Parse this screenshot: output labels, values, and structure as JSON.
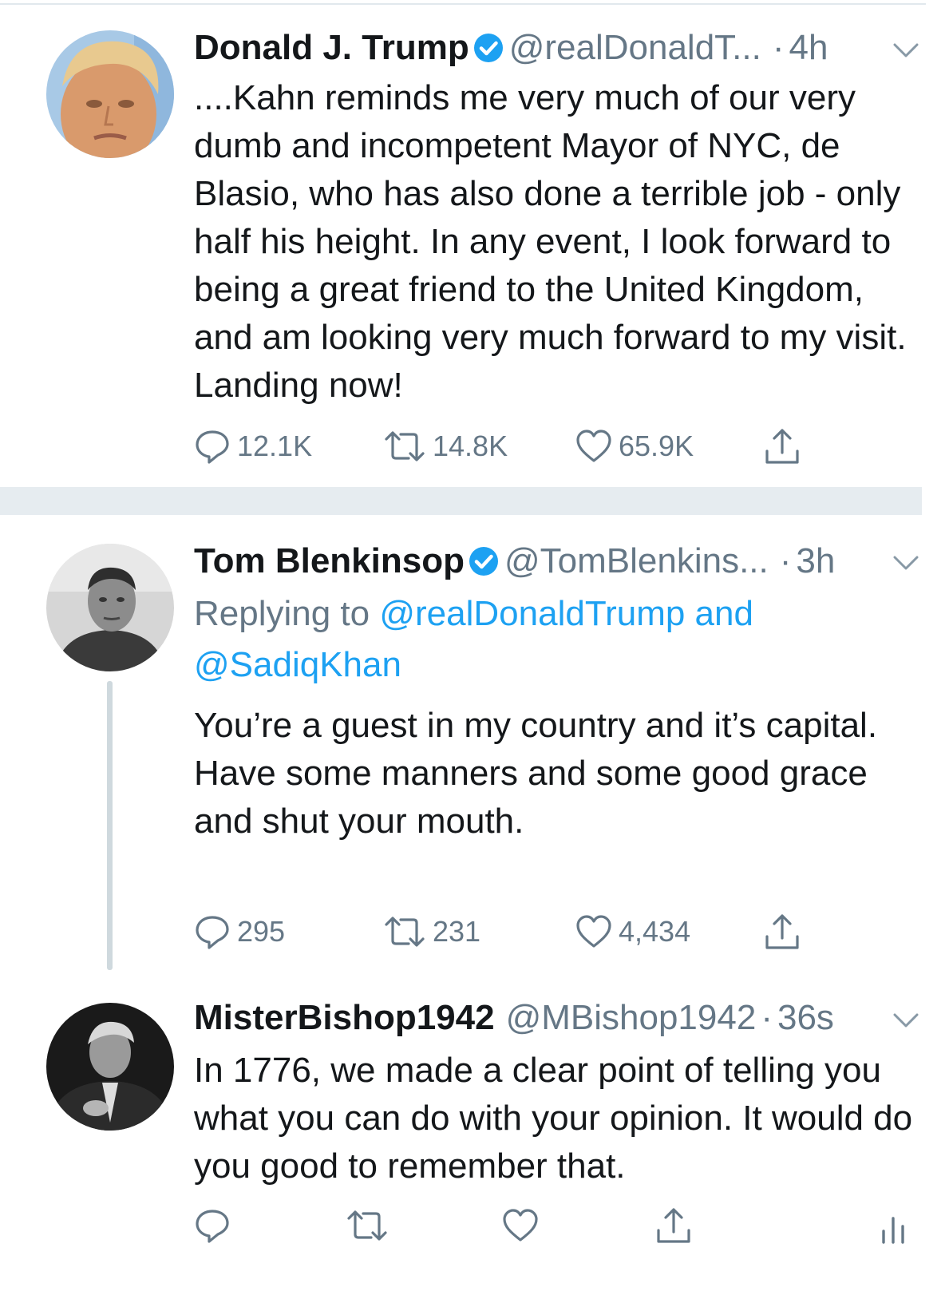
{
  "colors": {
    "link": "#1da1f2",
    "muted": "#657786",
    "text": "#14171a",
    "separator": "#e6ecf0"
  },
  "tweets": [
    {
      "name": "Donald J. Trump",
      "handle": "@realDonaldT...",
      "dot": "·",
      "time": "4h",
      "verified": true,
      "text": "....Kahn reminds me very much of our very dumb and incompetent Mayor of NYC, de Blasio, who has also done a terrible job - only half his height. In any event, I look forward to being a great friend to the United Kingdom, and am looking very much forward to my visit. Landing now!",
      "replies": "12.1K",
      "retweets": "14.8K",
      "likes": "65.9K",
      "icons": {
        "reply": "reply-icon",
        "retweet": "retweet-icon",
        "like": "heart-icon",
        "share": "share-icon",
        "more": "chevron-down-icon"
      }
    },
    {
      "name": "Tom Blenkinsop",
      "handle": "@TomBlenkins...",
      "dot": "·",
      "time": "3h",
      "verified": true,
      "replying_prefix": "Replying to ",
      "replying_mentions": "@realDonaldTrump and @SadiqKhan",
      "text": "You’re a guest in my country and it’s capital.\nHave some manners and some good grace and shut your mouth.",
      "replies": "295",
      "retweets": "231",
      "likes": "4,434"
    },
    {
      "name": "MisterBishop1942",
      "handle": "@MBishop1942",
      "dot": "·",
      "time": "36s",
      "verified": false,
      "text": "In 1776, we made a clear point of telling you what you can do with your opinion. It would do you good to remember that.",
      "icons": {
        "analytics": "analytics-icon"
      }
    }
  ]
}
